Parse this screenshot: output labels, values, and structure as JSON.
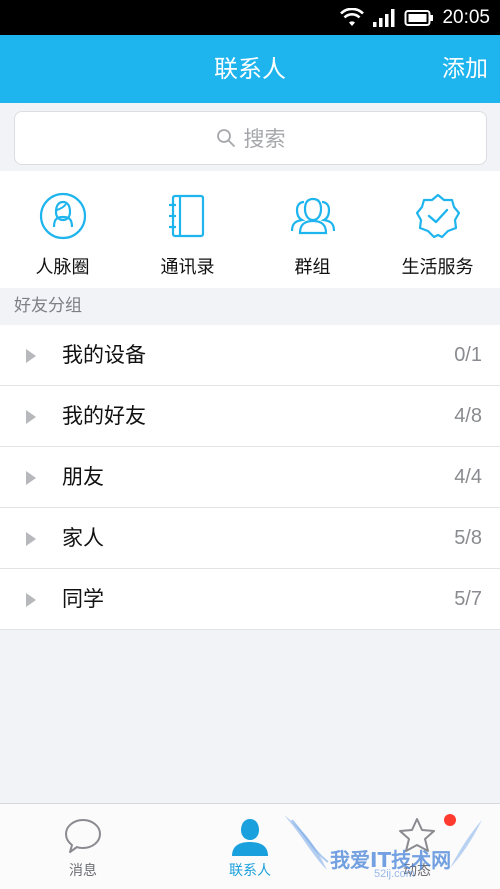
{
  "status_bar": {
    "time": "20:05"
  },
  "header": {
    "title": "联系人",
    "add_label": "添加"
  },
  "search": {
    "placeholder": "搜索"
  },
  "quick_actions": [
    {
      "label": "人脉圈",
      "icon": "people-circle-icon"
    },
    {
      "label": "通讯录",
      "icon": "address-book-icon"
    },
    {
      "label": "群组",
      "icon": "group-icon"
    },
    {
      "label": "生活服务",
      "icon": "verified-badge-icon"
    }
  ],
  "friend_groups": {
    "header": "好友分组",
    "items": [
      {
        "name": "我的设备",
        "count": "0/1"
      },
      {
        "name": "我的好友",
        "count": "4/8"
      },
      {
        "name": "朋友",
        "count": "4/4"
      },
      {
        "name": "家人",
        "count": "5/8"
      },
      {
        "name": "同学",
        "count": "5/7"
      }
    ]
  },
  "tabs": [
    {
      "label": "消息",
      "icon": "chat-bubble-icon"
    },
    {
      "label": "联系人",
      "icon": "person-icon",
      "active": true
    },
    {
      "label": "动态",
      "icon": "star-icon",
      "has_badge": true
    }
  ],
  "watermark": {
    "text": "我爱IT技术网",
    "subtext": "52ij.com"
  },
  "colors": {
    "accent": "#1eb4ee",
    "active_tab": "#1aa0dc",
    "badge": "#ff3b30"
  }
}
